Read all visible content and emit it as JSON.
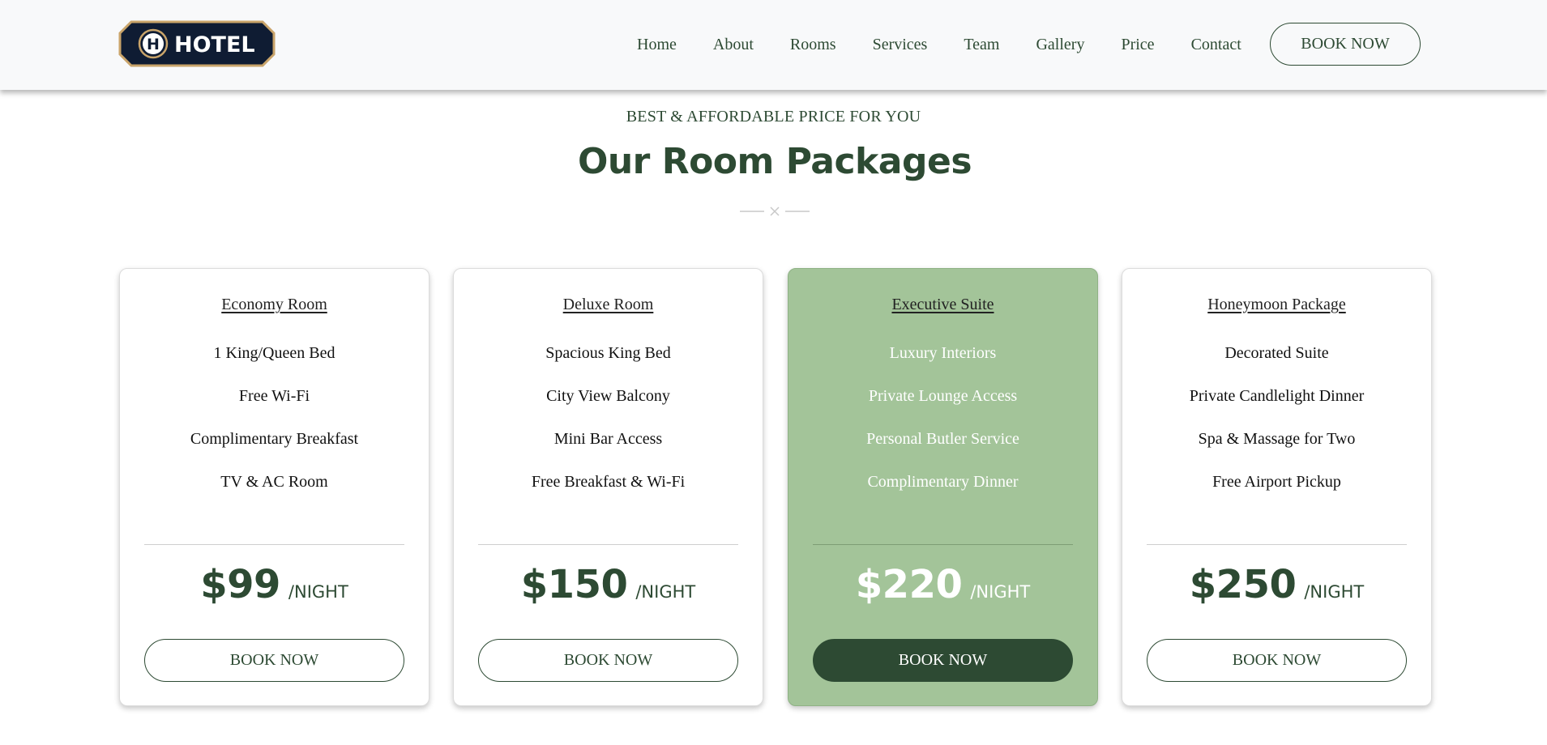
{
  "brand": {
    "logo_text": "HOTEL",
    "logo_letter": "H",
    "color_navy": "#0f1c33",
    "color_gold": "#c9a46a"
  },
  "nav": {
    "items": [
      "Home",
      "About",
      "Rooms",
      "Services",
      "Team",
      "Gallery",
      "Price",
      "Contact"
    ],
    "cta_label": "BOOK NOW"
  },
  "section": {
    "subtitle": "BEST & AFFORDABLE PRICE FOR YOU",
    "title": "Our Room Packages"
  },
  "packages": [
    {
      "name": "Economy Room",
      "features": [
        "1 King/Queen Bed",
        "Free Wi-Fi",
        "Complimentary Breakfast",
        "TV & AC Room"
      ],
      "price": "$99",
      "per": "/NIGHT",
      "button": "BOOK NOW",
      "featured": false
    },
    {
      "name": "Deluxe Room",
      "features": [
        "Spacious King Bed",
        "City View Balcony",
        "Mini Bar Access",
        "Free Breakfast & Wi-Fi"
      ],
      "price": "$150",
      "per": "/NIGHT",
      "button": "BOOK NOW",
      "featured": false
    },
    {
      "name": "Executive Suite",
      "features": [
        "Luxury Interiors",
        "Private Lounge Access",
        "Personal Butler Service",
        "Complimentary Dinner"
      ],
      "price": "$220",
      "per": "/NIGHT",
      "button": "BOOK NOW",
      "featured": true
    },
    {
      "name": "Honeymoon Package",
      "features": [
        "Decorated Suite",
        "Private Candlelight Dinner",
        "Spa & Massage for Two",
        "Free Airport Pickup"
      ],
      "price": "$250",
      "per": "/NIGHT",
      "button": "BOOK NOW",
      "featured": false
    }
  ],
  "colors": {
    "primary": "#2d4a33",
    "featured_bg": "#a3c499",
    "header_bg": "#f8f9fa"
  }
}
